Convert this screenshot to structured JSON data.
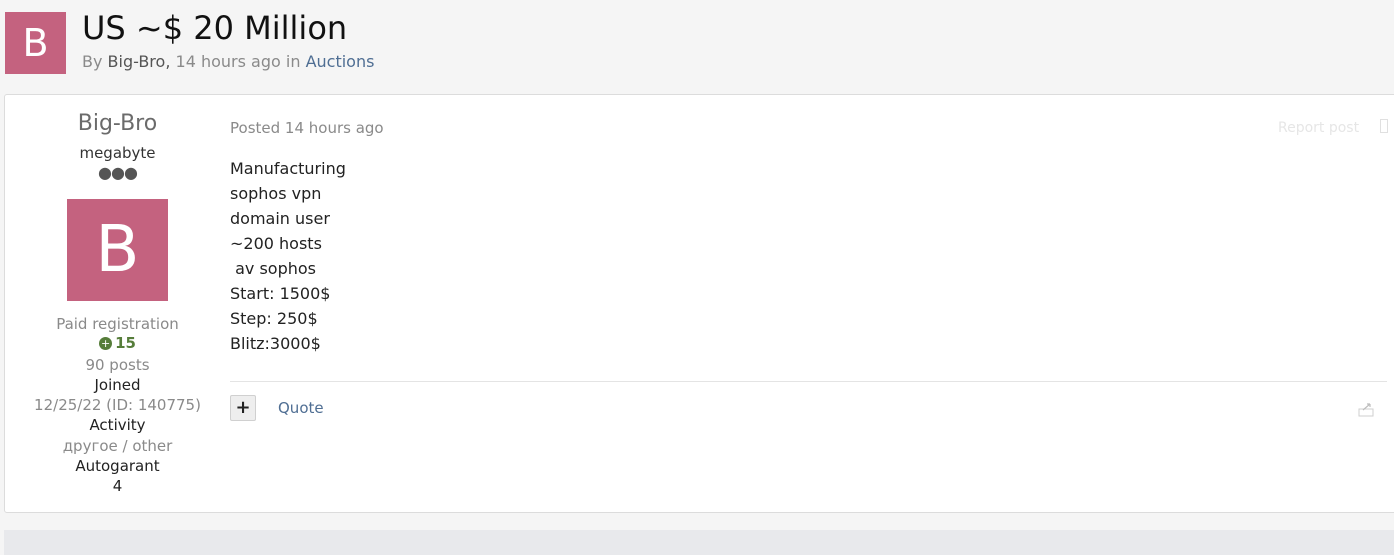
{
  "topic": {
    "avatar_letter": "B",
    "title": "US ~$ 20 Million",
    "by_label": "By",
    "author": "Big-Bro",
    "separator": ",",
    "time": "14 hours ago",
    "in_label": "in",
    "forum": "Auctions"
  },
  "author_panel": {
    "name": "Big-Bro",
    "rank": "megabyte",
    "pips": "●●●",
    "avatar_letter": "B",
    "group": "Paid registration",
    "reputation_icon": "plus-circle-icon",
    "reputation": "15",
    "posts": "90 posts",
    "joined_label": "Joined",
    "joined_value": "12/25/22 (ID: 140775)",
    "activity_label": "Activity",
    "activity_value": "другое / other",
    "autogarant_label": "Autogarant",
    "autogarant_value": "4",
    "autogarant_icon": ""
  },
  "post": {
    "posted": "Posted 14 hours ago",
    "report": "Report post",
    "body": [
      "Manufacturing",
      "sophos vpn",
      "domain user",
      "~200 hosts",
      " av sophos",
      "Start: 1500$",
      "Step: 250$",
      "Blitz:3000$"
    ],
    "plus_label": "+",
    "quote": "Quote"
  },
  "colors": {
    "avatar": "#c4627f",
    "link": "#4f6e93",
    "reputation": "#567d3a"
  }
}
